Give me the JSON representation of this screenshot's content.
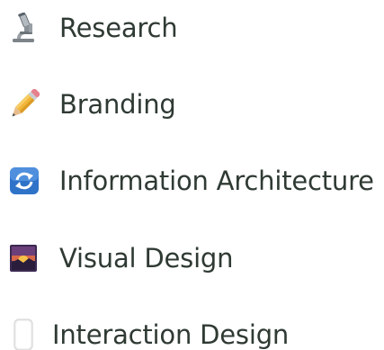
{
  "menu": {
    "items": [
      {
        "label": "Research",
        "icon": "microscope-icon"
      },
      {
        "label": "Branding",
        "icon": "pencil-icon"
      },
      {
        "label": "Information Architecture",
        "icon": "refresh-arrows-icon"
      },
      {
        "label": "Visual Design",
        "icon": "sunset-picture-icon"
      },
      {
        "label": "Interaction Design",
        "icon": "phone-icon"
      }
    ],
    "colors": {
      "text": "#2f3a33",
      "background": "#ffffff",
      "refresh_blue": "#2f73c9",
      "pencil_yellow": "#f2b63b",
      "pencil_tip": "#e38f6d"
    }
  }
}
